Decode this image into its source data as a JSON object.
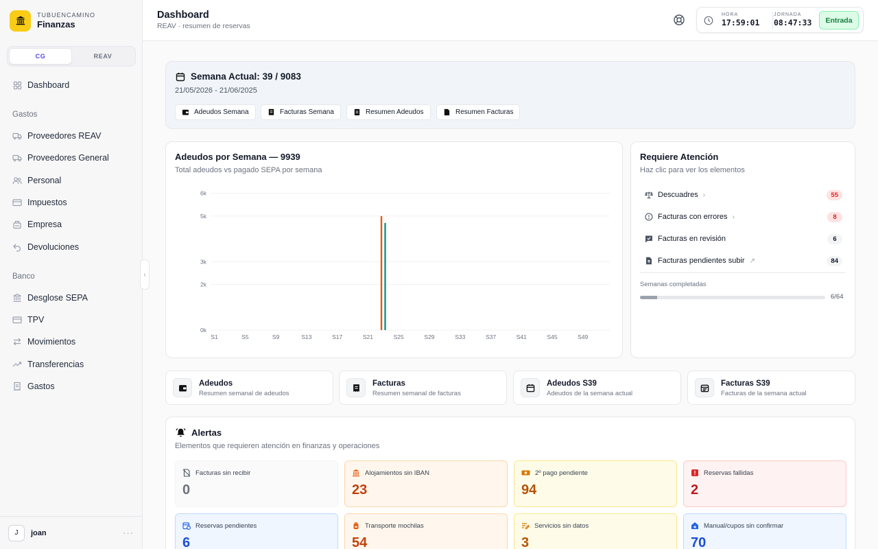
{
  "brand": {
    "sup": "TUBUENCAMINO",
    "name": "Finanzas"
  },
  "segment": {
    "options": [
      "CG",
      "REAV"
    ],
    "active": "CG"
  },
  "sidebar": {
    "dashboard": "Dashboard",
    "gastos_title": "Gastos",
    "gastos_items": [
      "Proveedores REAV",
      "Proveedores General",
      "Personal",
      "Impuestos",
      "Empresa",
      "Devoluciones"
    ],
    "banco_title": "Banco",
    "banco_items": [
      "Desglose SEPA",
      "TPV",
      "Movimientos",
      "Transferencias",
      "Gastos"
    ]
  },
  "user": {
    "initial": "J",
    "name": "joan",
    "more": "···"
  },
  "header": {
    "title": "Dashboard",
    "subtitle": "REAV · resumen de reservas",
    "hora_label": "HORA",
    "hora_value": "17:59:01",
    "jornada_label": "JORNADA",
    "jornada_value": "08:47:33",
    "entrada": "Entrada"
  },
  "week": {
    "title": "Semana Actual: 39 / 9083",
    "range": "21/05/2026 - 21/06/2025",
    "buttons": [
      "Adeudos Semana",
      "Facturas Semana",
      "Resumen Adeudos",
      "Resumen Facturas"
    ]
  },
  "chart": {
    "title": "Adeudos por Semana — 9939",
    "subtitle": "Total adeudos vs pagado SEPA por semana"
  },
  "chart_data": {
    "type": "bar",
    "title": "Adeudos por Semana — 9939",
    "subtitle": "Total adeudos vs pagado SEPA por semana",
    "y_ticks": [
      "0k",
      "2k",
      "3k",
      "5k",
      "6k"
    ],
    "ylim": [
      0,
      6200
    ],
    "x_ticks": [
      "S1",
      "S5",
      "S9",
      "S13",
      "S17",
      "S21",
      "S25",
      "S29",
      "S33",
      "S37",
      "S41",
      "S45",
      "S49"
    ],
    "categories": [
      "S1",
      "S2",
      "S3",
      "S4",
      "S5",
      "S6",
      "S7",
      "S8",
      "S9",
      "S10",
      "S11",
      "S12",
      "S13",
      "S14",
      "S15",
      "S16",
      "S17",
      "S18",
      "S19",
      "S20",
      "S21",
      "S22",
      "S23",
      "S24",
      "S25",
      "S26",
      "S27",
      "S28",
      "S29",
      "S30",
      "S31",
      "S32",
      "S33",
      "S34",
      "S35",
      "S36",
      "S37",
      "S38",
      "S39",
      "S40",
      "S41",
      "S42",
      "S43",
      "S44",
      "S45",
      "S46",
      "S47",
      "S48",
      "S49",
      "S50",
      "S51",
      "S52"
    ],
    "series": [
      {
        "color": "#ea580c",
        "values": [
          0,
          0,
          0,
          0,
          0,
          0,
          0,
          0,
          0,
          0,
          0,
          0,
          0,
          0,
          0,
          0,
          0,
          0,
          0,
          0,
          0,
          0,
          5000,
          0,
          0,
          0,
          0,
          0,
          0,
          0,
          0,
          0,
          0,
          0,
          0,
          0,
          0,
          0,
          0,
          0,
          0,
          0,
          0,
          0,
          0,
          0,
          0,
          0,
          0,
          0,
          0,
          0
        ]
      },
      {
        "color": "#0d9488",
        "values": [
          0,
          0,
          0,
          0,
          0,
          0,
          0,
          0,
          0,
          0,
          0,
          0,
          0,
          0,
          0,
          0,
          0,
          0,
          0,
          0,
          0,
          0,
          4700,
          0,
          0,
          0,
          0,
          0,
          0,
          0,
          0,
          0,
          0,
          0,
          0,
          0,
          0,
          0,
          0,
          0,
          0,
          0,
          0,
          0,
          0,
          0,
          0,
          0,
          0,
          0,
          0,
          0
        ]
      }
    ],
    "grid": true,
    "legend": "none"
  },
  "attention": {
    "title": "Requiere Atención",
    "subtitle": "Haz clic para ver los elementos",
    "rows": [
      {
        "label": "Descuadres",
        "count": "55",
        "tone": "red"
      },
      {
        "label": "Facturas con errores",
        "count": "8",
        "tone": "red"
      },
      {
        "label": "Facturas en revisión",
        "count": "6",
        "tone": "gray"
      },
      {
        "label": "Facturas pendientes subir",
        "count": "84",
        "tone": "gray"
      }
    ],
    "progress_label": "Semanas completadas",
    "progress_value": "6/64",
    "progress_fraction": 0.094
  },
  "quick": [
    {
      "title": "Adeudos",
      "sub": "Resumen semanal de adeudos"
    },
    {
      "title": "Facturas",
      "sub": "Resumen semanal de facturas"
    },
    {
      "title": "Adeudos S39",
      "sub": "Adeudos de la semana actual"
    },
    {
      "title": "Facturas S39",
      "sub": "Facturas de la semana actual"
    }
  ],
  "alerts": {
    "title": "Alertas",
    "subtitle": "Elementos que requieren atención en finanzas y operaciones",
    "tiles": [
      {
        "label": "Facturas sin recibir",
        "value": "0",
        "bg": "#fafafa",
        "border": "#f3f4f6",
        "color": "#6b7280"
      },
      {
        "label": "Alojamientos sin IBAN",
        "value": "23",
        "bg": "#fff7ed",
        "border": "#fed7aa",
        "color": "#c2410c"
      },
      {
        "label": "2º pago pendiente",
        "value": "94",
        "bg": "#fefce8",
        "border": "#fde68a",
        "color": "#b45309"
      },
      {
        "label": "Reservas fallidas",
        "value": "2",
        "bg": "#fef2f2",
        "border": "#fecaca",
        "color": "#b91c1c"
      },
      {
        "label": "Reservas pendientes",
        "value": "6",
        "bg": "#eff6ff",
        "border": "#bfdbfe",
        "color": "#1d4ed8"
      },
      {
        "label": "Transporte mochilas",
        "value": "54",
        "bg": "#fff7ed",
        "border": "#fed7aa",
        "color": "#c2410c"
      },
      {
        "label": "Servicios sin datos",
        "value": "3",
        "bg": "#fefce8",
        "border": "#fde68a",
        "color": "#b45309"
      },
      {
        "label": "Manual/cupos sin confirmar",
        "value": "70",
        "bg": "#eff6ff",
        "border": "#bfdbfe",
        "color": "#1d4ed8"
      }
    ]
  }
}
